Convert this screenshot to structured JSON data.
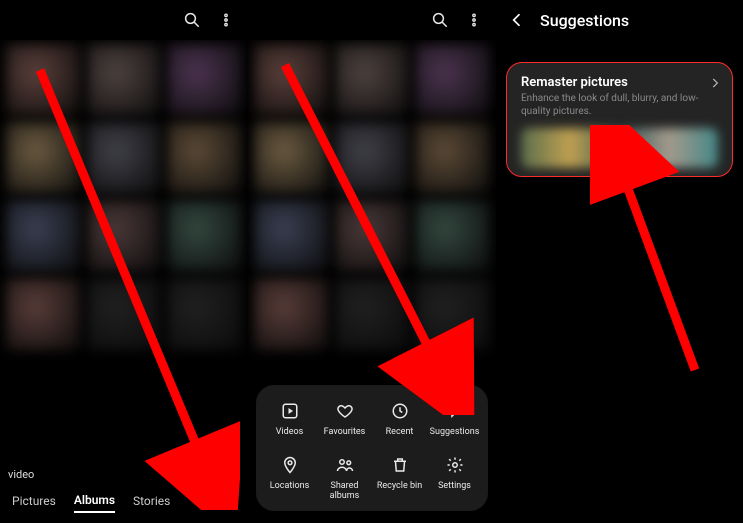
{
  "panel1": {
    "caption": "video",
    "tabs": {
      "pictures": "Pictures",
      "albums": "Albums",
      "stories": "Stories"
    }
  },
  "sheet": {
    "videos": "Videos",
    "favourites": "Favourites",
    "recent": "Recent",
    "suggestions": "Suggestions",
    "locations": "Locations",
    "shared": "Shared albums",
    "recycle": "Recycle bin",
    "settings": "Settings"
  },
  "panel3": {
    "title": "Suggestions",
    "card": {
      "title": "Remaster pictures",
      "subtitle": "Enhance the look of dull, blurry, and low-quality pictures."
    }
  },
  "thumbColors": [
    [
      "#5a3f3a",
      "#4e4240",
      "#4b334f"
    ],
    [
      "#6b5a40",
      "#404048",
      "#5c4a36"
    ],
    [
      "#3a3f52",
      "#4a3838",
      "#33473f"
    ],
    [
      "#583c38",
      "#202020",
      "#202020"
    ]
  ]
}
